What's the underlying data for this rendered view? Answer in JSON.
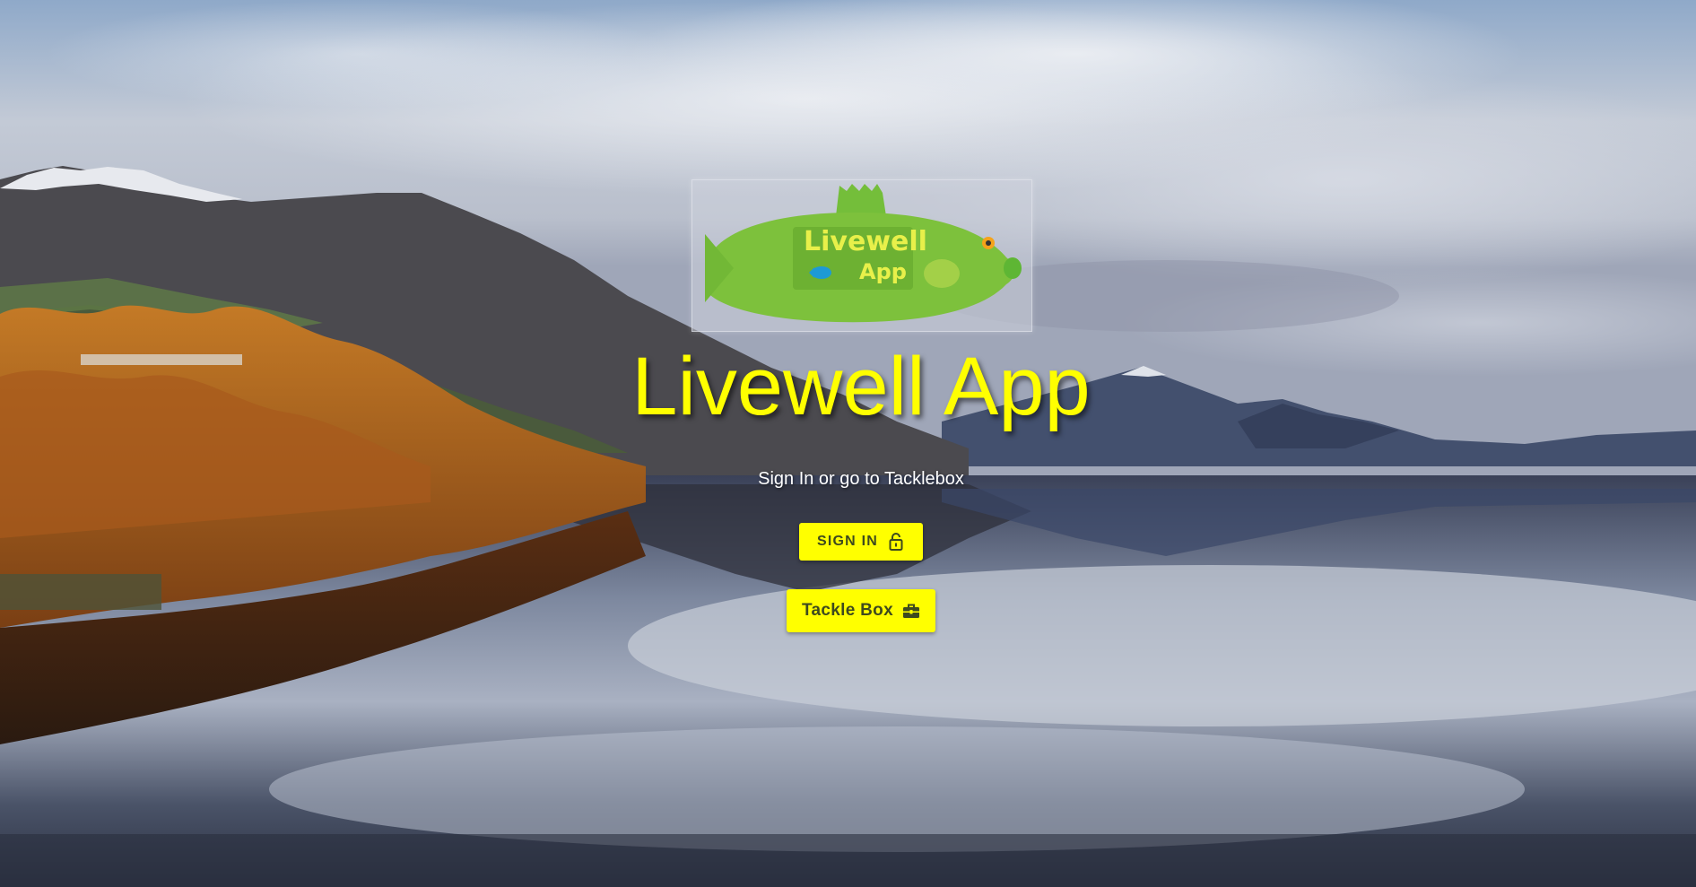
{
  "app": {
    "title": "Livewell App",
    "subtitle": "Sign In or go to Tacklebox"
  },
  "logo": {
    "text_line1": "Livewell",
    "text_line2": "App",
    "fish_color": "#7dc13c"
  },
  "buttons": {
    "sign_in_label": "SIGN IN",
    "sign_in_icon": "lock-icon",
    "tackle_box_label": "Tackle Box",
    "tackle_box_icon": "toolbox-icon"
  },
  "colors": {
    "accent": "#ffff00",
    "button_text": "#3e4a1e",
    "subtitle": "#ffffff"
  }
}
